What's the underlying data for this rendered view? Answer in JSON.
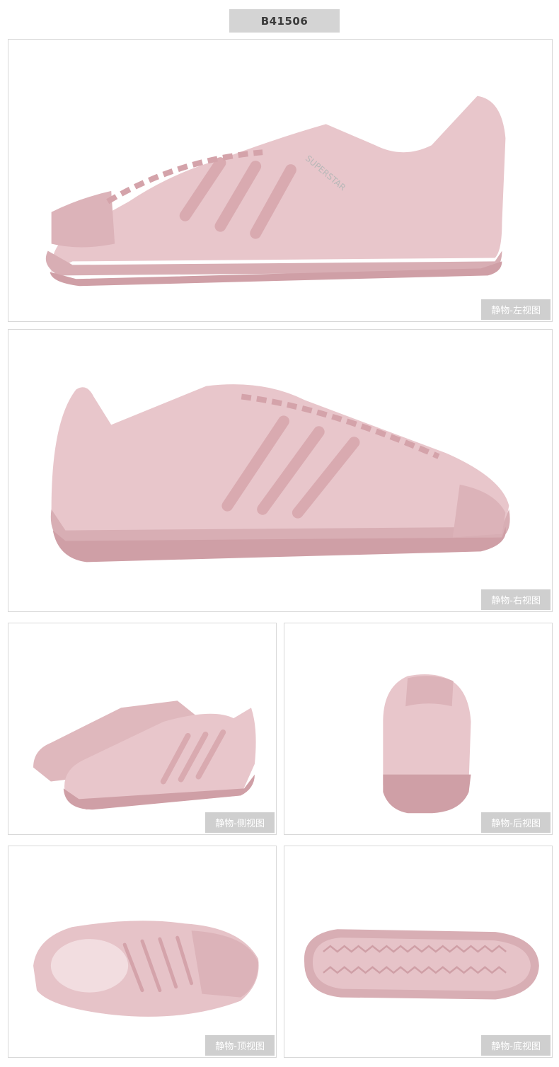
{
  "product": {
    "sku": "B41506"
  },
  "colors": {
    "shoe": "#e6c3c8",
    "shoe_dark": "#d4a8ae",
    "sole": "#dcb0b6",
    "label_bg": "#cfcfcf"
  },
  "views": [
    {
      "label": "静物-左视图"
    },
    {
      "label": "静物-右视图"
    },
    {
      "label": "静物-侧视图"
    },
    {
      "label": "静物-后视图"
    },
    {
      "label": "静物-顶视图"
    },
    {
      "label": "静物-底视图"
    }
  ]
}
